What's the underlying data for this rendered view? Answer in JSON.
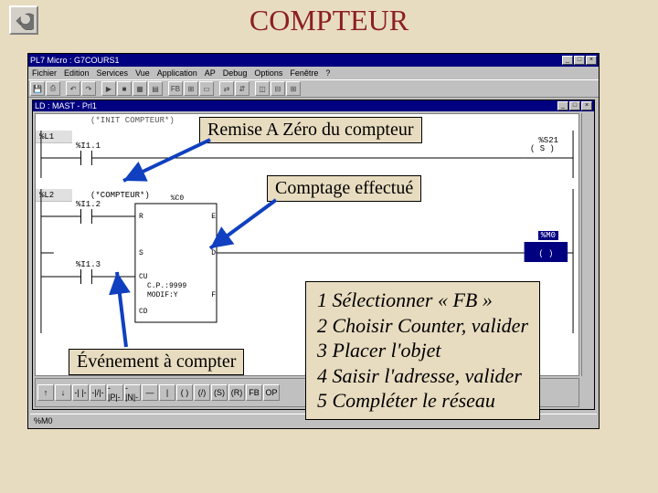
{
  "slide_title": "COMPTEUR",
  "app": {
    "title": "PL7 Micro : G7COURS1",
    "menus": [
      "Fichier",
      "Edition",
      "Services",
      "Vue",
      "Application",
      "AP",
      "Debug",
      "Options",
      "Fenêtre",
      "?"
    ],
    "inner_title": "LD : MAST - Prl1",
    "status": "%M0"
  },
  "ladder": {
    "net1_comment": "(*INIT COMPTEUR*)",
    "rung_labels": [
      "%L1",
      "%L2"
    ],
    "inputs": {
      "i11": "%I1.1",
      "i12": "%I1.2",
      "i13": "%I1.3"
    },
    "counter": {
      "name": "(*COMPTEUR*)",
      "id": "%C0",
      "pins_left": [
        "R",
        "S",
        "CU",
        "CD"
      ],
      "pins_right": [
        "E",
        "D",
        "F"
      ],
      "preset_label": "C.P.:9999",
      "mode": "MODIF:Y"
    },
    "coil1": {
      "addr": "%S21",
      "type": "( S )"
    },
    "coil2": {
      "addr": "%M0",
      "type": "(   )"
    }
  },
  "callouts": {
    "raz": "Remise A Zéro du compteur",
    "comptage": "Comptage effectué",
    "evenement": "Événement à compter"
  },
  "instructions": {
    "l1": "1 Sélectionner « FB »",
    "l2": "2 Choisir Counter, valider",
    "l3": "3 Placer l'objet",
    "l4": "4 Saisir l'adresse, valider",
    "l5": "5 Compléter le réseau"
  },
  "icons": {
    "back": "↶"
  }
}
